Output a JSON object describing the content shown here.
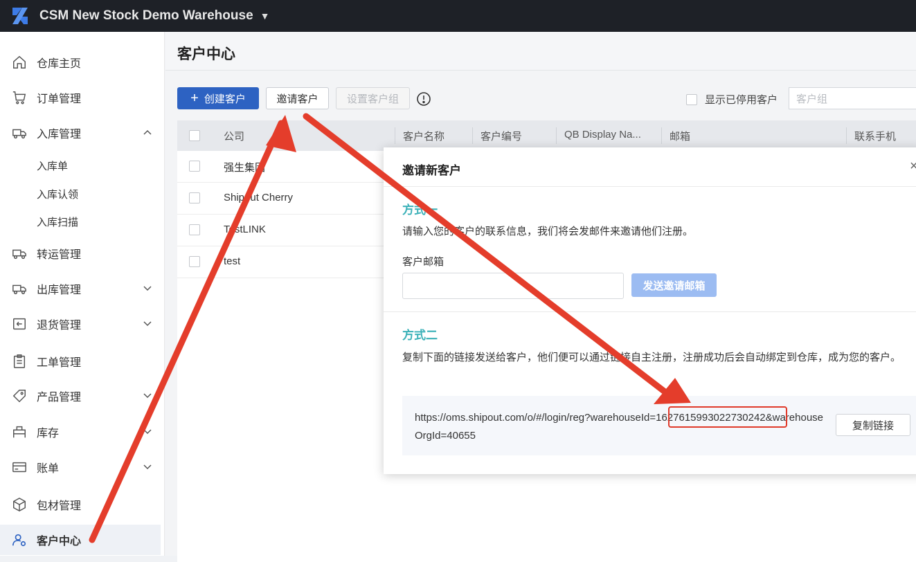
{
  "topbar": {
    "title": "CSM New Stock Demo Warehouse"
  },
  "sidebar": {
    "items": [
      {
        "label": "仓库主页",
        "icon": "home-icon"
      },
      {
        "label": "订单管理",
        "icon": "cart-icon"
      },
      {
        "label": "入库管理",
        "icon": "inbound-truck-icon",
        "expanded": true
      },
      {
        "label": "转运管理",
        "icon": "transfer-truck-icon"
      },
      {
        "label": "出库管理",
        "icon": "outbound-truck-icon"
      },
      {
        "label": "退货管理",
        "icon": "return-icon"
      },
      {
        "label": "工单管理",
        "icon": "clipboard-icon"
      },
      {
        "label": "产品管理",
        "icon": "tag-icon"
      },
      {
        "label": "库存",
        "icon": "inventory-icon"
      },
      {
        "label": "账单",
        "icon": "card-icon"
      },
      {
        "label": "包材管理",
        "icon": "box-icon"
      },
      {
        "label": "客户中心",
        "icon": "customer-gear-icon",
        "active": true
      }
    ],
    "subitems": [
      "入库单",
      "入库认领",
      "入库扫描"
    ]
  },
  "page": {
    "title": "客户中心"
  },
  "toolbar": {
    "create_label": "创建客户",
    "invite_label": "邀请客户",
    "set_group_label": "设置客户组",
    "show_disabled_label": "显示已停用客户",
    "group_placeholder": "客户组"
  },
  "table": {
    "columns": [
      "公司",
      "客户名称",
      "客户编号",
      "QB Display Na...",
      "邮箱",
      "联系手机"
    ],
    "rows": [
      "强生集团",
      "Shipout Cherry",
      "TestLINK",
      "test"
    ]
  },
  "modal": {
    "title": "邀请新客户",
    "method1_title": "方式一",
    "method1_desc": "请输入您的客户的联系信息，我们将会发邮件来邀请他们注册。",
    "email_label": "客户邮箱",
    "send_label": "发送邀请邮箱",
    "method2_title": "方式二",
    "method2_desc": "复制下面的链接发送给客户，他们便可以通过链接自主注册，注册成功后会自动绑定到仓库，成为您的客户。",
    "link": "https://oms.shipout.com/o/#/login/reg?warehouseId=1627615993022730242&warehouseOrgId=40655",
    "copy_label": "复制链接"
  },
  "colors": {
    "primary": "#2d62c2",
    "accent": "#3bb1b8",
    "annotation": "#e03a2a",
    "topbar": "#1e2127"
  }
}
